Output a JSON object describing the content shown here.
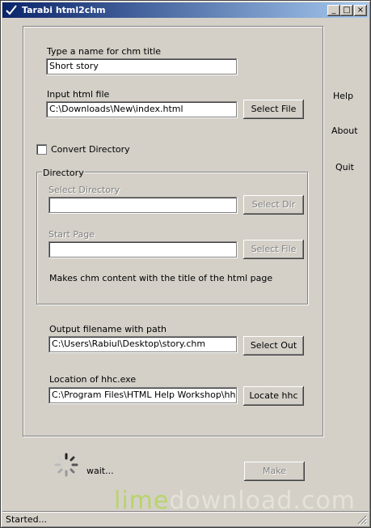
{
  "window": {
    "title": "Tarabi html2chm",
    "minimize": "_",
    "maximize": "□",
    "close": "×"
  },
  "form": {
    "chm_title_label": "Type a name for chm title",
    "chm_title_value": "Short story",
    "input_html_label": "Input html file",
    "input_html_value": "C:\\Downloads\\New\\index.html",
    "select_file_label": "Select File",
    "convert_dir_label": "Convert Directory",
    "convert_dir_checked": false
  },
  "directory_group": {
    "title": "Directory",
    "select_dir_label": "Select Directory",
    "select_dir_value": "",
    "select_dir_button": "Select Dir",
    "start_page_label": "Start Page",
    "start_page_value": "",
    "select_file_button": "Select File",
    "note": "Makes chm content with the title of the html page"
  },
  "output": {
    "label": "Output filename with path",
    "value": "C:\\Users\\Rabiul\\Desktop\\story.chm",
    "button": "Select Out"
  },
  "hhc": {
    "label": "Location of hhc.exe",
    "value": "C:\\Program Files\\HTML Help Workshop\\hhc.ex",
    "button": "Locate hhc"
  },
  "side_menu": {
    "help": "Help",
    "about": "About",
    "quit": "Quit"
  },
  "progress": {
    "text": "wait...",
    "make_button": "Make"
  },
  "status": {
    "text": "Started..."
  },
  "watermark": {
    "part1": "lime",
    "part2": "download.com"
  }
}
